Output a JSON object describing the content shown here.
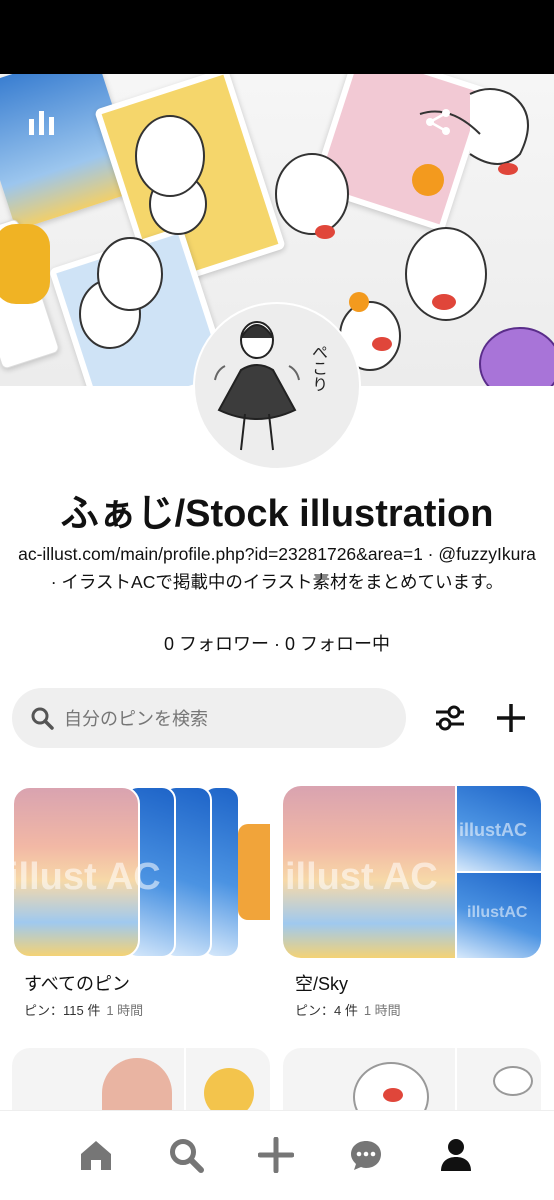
{
  "profile": {
    "name": "ふぁじ/Stock illustration",
    "bio": "ac-illust.com/main/profile.php?id=23281726&area=1 · @fuzzyIkura · イラストACで掲載中のイラスト素材をまとめています。",
    "follow_stats": "0 フォロワー · 0 フォロー中",
    "avatar_caption": "ぺこり"
  },
  "search": {
    "placeholder": "自分のピンを検索"
  },
  "boards": [
    {
      "title": "すべてのピン",
      "count": "ピン：115 件",
      "time": "1 時間"
    },
    {
      "title": "空/Sky",
      "count": "ピン：4 件",
      "time": "1 時間"
    }
  ],
  "watermarks": {
    "main": "illust AC",
    "small": "illustAC"
  },
  "icons": {
    "cover_left": "stats-icon",
    "cover_share": "share-icon",
    "cover_more": "more-icon",
    "filter": "sliders-icon",
    "add": "plus-icon",
    "nav": [
      "home-icon",
      "search-icon",
      "create-icon",
      "messages-icon",
      "profile-icon"
    ]
  },
  "colors": {
    "text": "#111111",
    "muted": "#767676",
    "search_bg": "#efefef",
    "nav_icon": "#767676",
    "nav_active": "#111111"
  }
}
